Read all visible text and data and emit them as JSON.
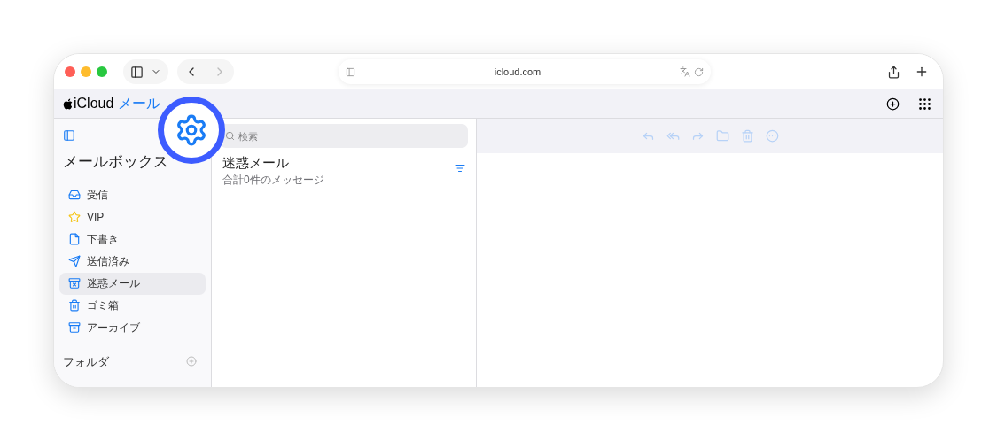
{
  "browser": {
    "url": "icloud.com"
  },
  "app": {
    "brand": "iCloud",
    "title": "メール"
  },
  "search": {
    "placeholder": "検索"
  },
  "sidebar": {
    "heading": "メールボックス",
    "items": [
      {
        "label": "受信",
        "kind": "inbox",
        "selected": false
      },
      {
        "label": "VIP",
        "kind": "vip",
        "selected": false
      },
      {
        "label": "下書き",
        "kind": "drafts",
        "selected": false
      },
      {
        "label": "送信済み",
        "kind": "sent",
        "selected": false
      },
      {
        "label": "迷惑メール",
        "kind": "junk",
        "selected": true
      },
      {
        "label": "ゴミ箱",
        "kind": "trash",
        "selected": false
      },
      {
        "label": "アーカイブ",
        "kind": "archive",
        "selected": false
      }
    ],
    "folders_heading": "フォルダ"
  },
  "message_list": {
    "title": "迷惑メール",
    "subtitle": "合計0件のメッセージ"
  }
}
